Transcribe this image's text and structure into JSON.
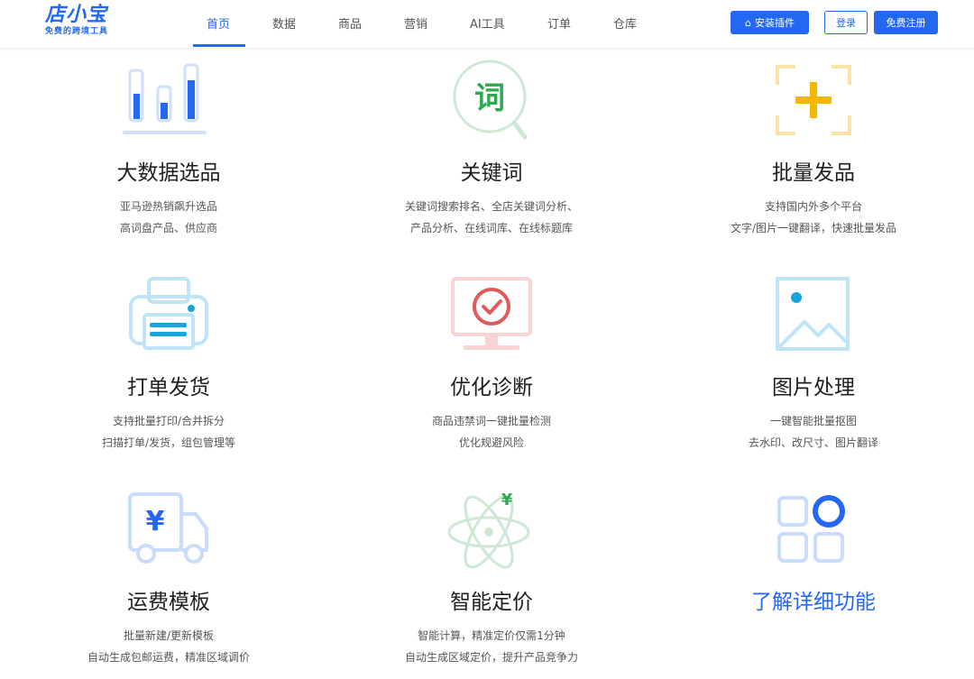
{
  "logo": {
    "name": "店小宝",
    "tagline": "免费的跨境工具"
  },
  "nav": {
    "items": [
      "首页",
      "数据",
      "商品",
      "营销",
      "AI工具",
      "订单",
      "仓库"
    ],
    "active": "首页"
  },
  "header_buttons": {
    "install": "安装插件",
    "login": "登录",
    "register": "免费注册"
  },
  "features": [
    {
      "icon": "bar-chart-icon",
      "title": "大数据选品",
      "lines": [
        "亚马逊热销飙升选品",
        "高词盘产品、供应商"
      ]
    },
    {
      "icon": "keyword-magnifier-icon",
      "icon_text": "词",
      "title": "关键词",
      "lines": [
        "关键词搜索排名、全店关键词分析、",
        "产品分析、在线词库、在线标题库"
      ]
    },
    {
      "icon": "batch-add-icon",
      "title": "批量发品",
      "lines": [
        "支持国内外多个平台",
        "文字/图片一键翻译，快速批量发品"
      ]
    },
    {
      "icon": "printer-icon",
      "title": "打单发货",
      "lines": [
        "支持批量打印/合并拆分",
        "扫描打单/发货，组包管理等"
      ]
    },
    {
      "icon": "monitor-check-icon",
      "title": "优化诊断",
      "lines": [
        "商品违禁词一键批量检测",
        "优化规避风险"
      ]
    },
    {
      "icon": "image-icon",
      "title": "图片处理",
      "lines": [
        "一键智能批量抠图",
        "去水印、改尺寸、图片翻译"
      ]
    },
    {
      "icon": "delivery-truck-icon",
      "icon_text": "¥",
      "title": "运费模板",
      "lines": [
        "批量新建/更新模板",
        "自动生成包邮运费，精准区域调价"
      ]
    },
    {
      "icon": "atom-price-icon",
      "icon_text": "¥",
      "title": "智能定价",
      "lines": [
        "智能计算，精准定价仅需1分钟",
        "自动生成区域定价，提升产品竞争力"
      ]
    },
    {
      "icon": "grid-apps-icon",
      "title": "了解详细功能",
      "lines": []
    }
  ],
  "colors": {
    "brand": "#2468f2",
    "green": "#2fa84f",
    "yellow": "#f5b800",
    "red": "#e05a5a"
  }
}
